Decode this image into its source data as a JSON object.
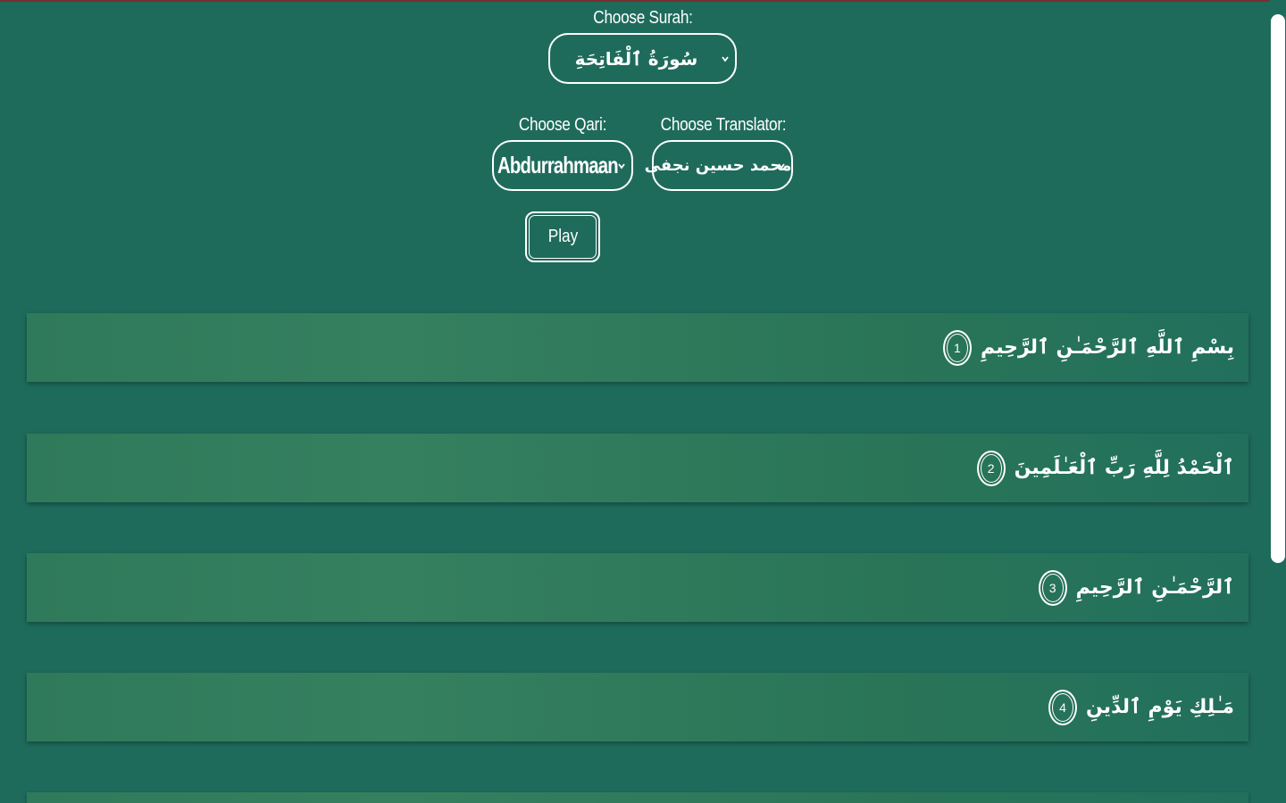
{
  "surah": {
    "label": "Choose Surah:",
    "selected": "سُورَةُ ٱلْفَاتِحَةِ"
  },
  "qari": {
    "label": "Choose Qari:",
    "selected": "Abdurrahmaan"
  },
  "translator": {
    "label": "Choose Translator:",
    "selected": "محمد حسين نجفى"
  },
  "play_label": "Play",
  "ayahs": [
    {
      "number": "1",
      "text": "بِسْمِ ٱللَّهِ ٱلرَّحْمَـٰنِ ٱلرَّحِيمِ"
    },
    {
      "number": "2",
      "text": "ٱلْحَمْدُ لِلَّهِ رَبِّ ٱلْعَـٰلَمِينَ"
    },
    {
      "number": "3",
      "text": "ٱلرَّحْمَـٰنِ ٱلرَّحِيمِ"
    },
    {
      "number": "4",
      "text": "مَـٰلِكِ يَوْمِ ٱلدِّينِ"
    }
  ],
  "colors": {
    "background": "#1e6b5c",
    "ayah_row": "#35805f",
    "foreground": "#ffffff"
  }
}
